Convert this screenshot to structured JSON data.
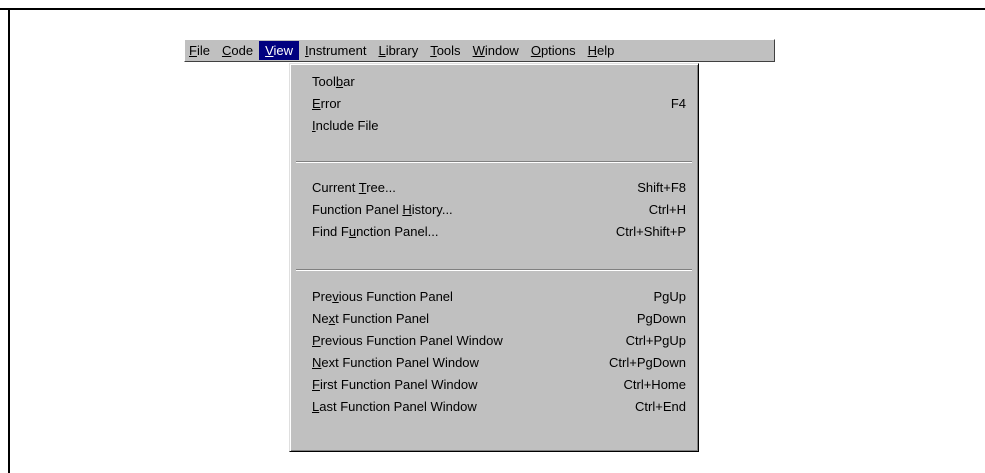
{
  "menubar": {
    "items": [
      {
        "pre": "",
        "key": "F",
        "post": "ile"
      },
      {
        "pre": "",
        "key": "C",
        "post": "ode"
      },
      {
        "pre": "",
        "key": "V",
        "post": "iew"
      },
      {
        "pre": "",
        "key": "I",
        "post": "nstrument"
      },
      {
        "pre": "",
        "key": "L",
        "post": "ibrary"
      },
      {
        "pre": "",
        "key": "T",
        "post": "ools"
      },
      {
        "pre": "",
        "key": "W",
        "post": "indow"
      },
      {
        "pre": "",
        "key": "O",
        "post": "ptions"
      },
      {
        "pre": "",
        "key": "H",
        "post": "elp"
      }
    ],
    "active_index": 2
  },
  "view_menu": {
    "items": [
      {
        "pre": "Tool",
        "key": "b",
        "post": "ar",
        "shortcut": ""
      },
      {
        "pre": "",
        "key": "E",
        "post": "rror",
        "shortcut": "F4"
      },
      {
        "pre": "",
        "key": "I",
        "post": "nclude File",
        "shortcut": ""
      },
      {
        "pre": "Current ",
        "key": "T",
        "post": "ree...",
        "shortcut": "Shift+F8"
      },
      {
        "pre": "Function Panel ",
        "key": "H",
        "post": "istory...",
        "shortcut": "Ctrl+H"
      },
      {
        "pre": "Find F",
        "key": "u",
        "post": "nction Panel...",
        "shortcut": "Ctrl+Shift+P"
      },
      {
        "pre": "Pre",
        "key": "v",
        "post": "ious Function Panel",
        "shortcut": "PgUp"
      },
      {
        "pre": "Ne",
        "key": "x",
        "post": "t Function Panel",
        "shortcut": "PgDown"
      },
      {
        "pre": "",
        "key": "P",
        "post": "revious Function Panel Window",
        "shortcut": "Ctrl+PgUp"
      },
      {
        "pre": "",
        "key": "N",
        "post": "ext Function Panel Window",
        "shortcut": "Ctrl+PgDown"
      },
      {
        "pre": "",
        "key": "F",
        "post": "irst Function Panel Window",
        "shortcut": "Ctrl+Home"
      },
      {
        "pre": "",
        "key": "L",
        "post": "ast Function Panel Window",
        "shortcut": "Ctrl+End"
      }
    ]
  }
}
